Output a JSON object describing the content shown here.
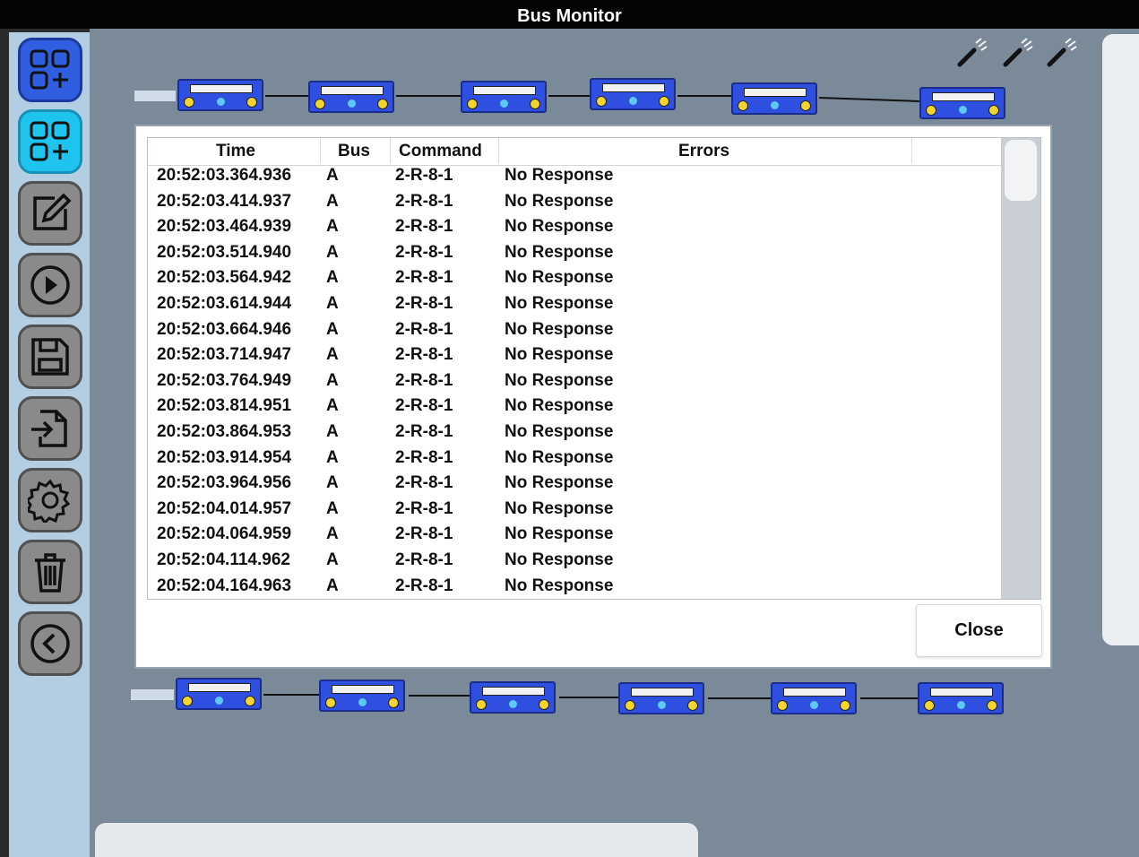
{
  "window": {
    "title": "Bus Monitor"
  },
  "sidebar": {
    "buttons": [
      {
        "name": "add-component-button",
        "icon": "grid-plus-icon",
        "style": "blue"
      },
      {
        "name": "add-component-alt-button",
        "icon": "grid-plus-icon",
        "style": "cyan"
      },
      {
        "name": "edit-button",
        "icon": "edit-icon",
        "style": "grey"
      },
      {
        "name": "run-button",
        "icon": "play-icon",
        "style": "grey"
      },
      {
        "name": "save-button",
        "icon": "save-icon",
        "style": "grey"
      },
      {
        "name": "import-button",
        "icon": "import-icon",
        "style": "grey"
      },
      {
        "name": "settings-button",
        "icon": "gear-icon",
        "style": "grey"
      },
      {
        "name": "delete-button",
        "icon": "trash-icon",
        "style": "grey"
      },
      {
        "name": "back-button",
        "icon": "back-icon",
        "style": "grey"
      }
    ]
  },
  "dialog": {
    "columns": {
      "time": "Time",
      "bus": "Bus",
      "command": "Command",
      "errors": "Errors"
    },
    "rows": [
      {
        "time": "20:52:03.364.936",
        "bus": "A",
        "command": "2-R-8-1",
        "error": "No Response"
      },
      {
        "time": "20:52:03.414.937",
        "bus": "A",
        "command": "2-R-8-1",
        "error": "No Response"
      },
      {
        "time": "20:52:03.464.939",
        "bus": "A",
        "command": "2-R-8-1",
        "error": "No Response"
      },
      {
        "time": "20:52:03.514.940",
        "bus": "A",
        "command": "2-R-8-1",
        "error": "No Response"
      },
      {
        "time": "20:52:03.564.942",
        "bus": "A",
        "command": "2-R-8-1",
        "error": "No Response"
      },
      {
        "time": "20:52:03.614.944",
        "bus": "A",
        "command": "2-R-8-1",
        "error": "No Response"
      },
      {
        "time": "20:52:03.664.946",
        "bus": "A",
        "command": "2-R-8-1",
        "error": "No Response"
      },
      {
        "time": "20:52:03.714.947",
        "bus": "A",
        "command": "2-R-8-1",
        "error": "No Response"
      },
      {
        "time": "20:52:03.764.949",
        "bus": "A",
        "command": "2-R-8-1",
        "error": "No Response"
      },
      {
        "time": "20:52:03.814.951",
        "bus": "A",
        "command": "2-R-8-1",
        "error": "No Response"
      },
      {
        "time": "20:52:03.864.953",
        "bus": "A",
        "command": "2-R-8-1",
        "error": "No Response"
      },
      {
        "time": "20:52:03.914.954",
        "bus": "A",
        "command": "2-R-8-1",
        "error": "No Response"
      },
      {
        "time": "20:52:03.964.956",
        "bus": "A",
        "command": "2-R-8-1",
        "error": "No Response"
      },
      {
        "time": "20:52:04.014.957",
        "bus": "A",
        "command": "2-R-8-1",
        "error": "No Response"
      },
      {
        "time": "20:52:04.064.959",
        "bus": "A",
        "command": "2-R-8-1",
        "error": "No Response"
      },
      {
        "time": "20:52:04.114.962",
        "bus": "A",
        "command": "2-R-8-1",
        "error": "No Response"
      },
      {
        "time": "20:52:04.164.963",
        "bus": "A",
        "command": "2-R-8-1",
        "error": "No Response"
      }
    ],
    "close_label": "Close"
  },
  "colors": {
    "titlebar": "#050505",
    "sidebar": "#b3cde3",
    "canvas": "#7a8a99",
    "button_blue": "#2f5fe0",
    "button_cyan": "#1ec3ee",
    "button_grey": "#8a8a8a",
    "coupler": "#2f4fe0"
  }
}
